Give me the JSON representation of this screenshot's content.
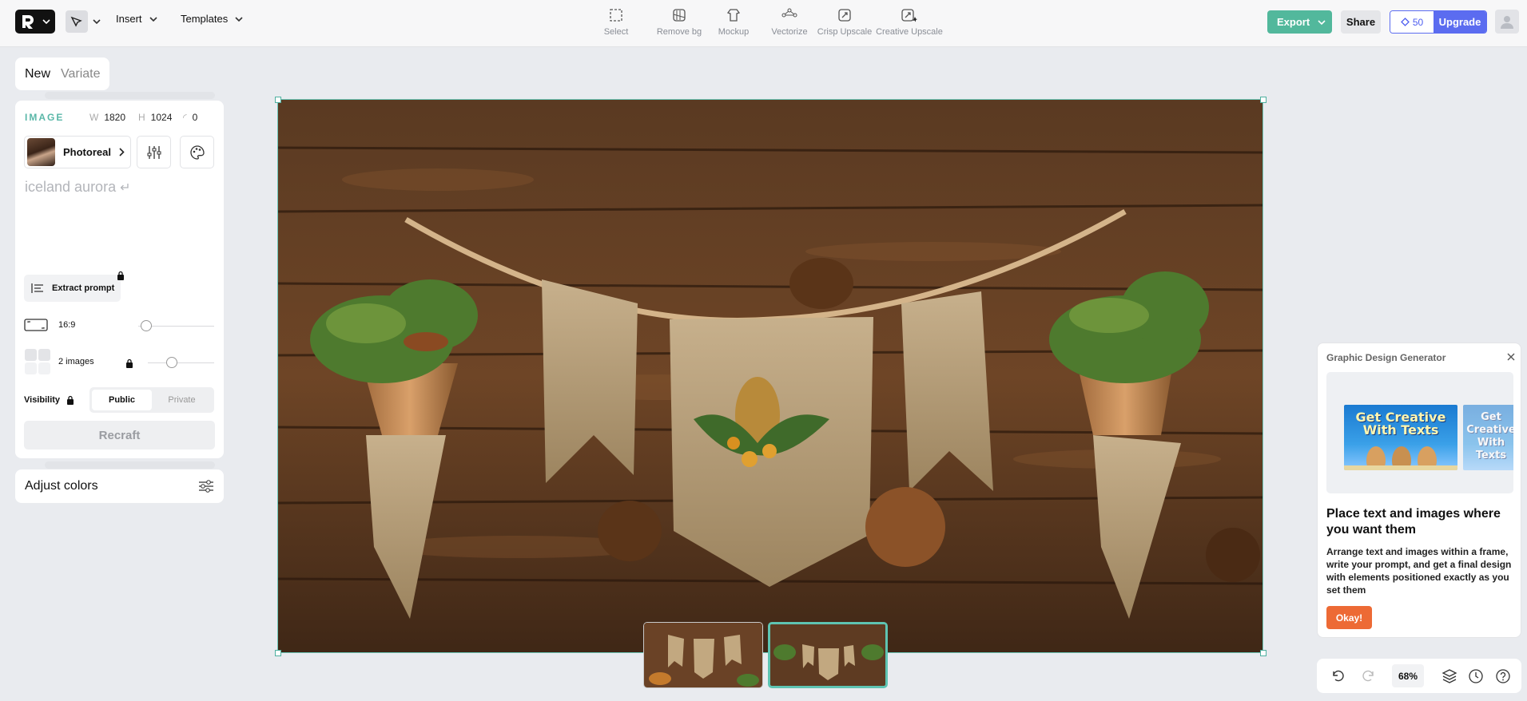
{
  "header": {
    "menus": {
      "insert": "Insert",
      "templates": "Templates"
    },
    "tools": [
      {
        "label": "Select",
        "icon": "select-icon"
      },
      {
        "label": "Remove bg",
        "icon": "remove-bg-icon"
      },
      {
        "label": "Mockup",
        "icon": "mockup-icon"
      },
      {
        "label": "Vectorize",
        "icon": "vectorize-icon"
      },
      {
        "label": "Crisp Upscale",
        "icon": "crisp-upscale-icon"
      },
      {
        "label": "Creative Upscale",
        "icon": "creative-upscale-icon"
      }
    ],
    "export_label": "Export",
    "share_label": "Share",
    "credits": "50",
    "upgrade_label": "Upgrade"
  },
  "panel": {
    "tabs": {
      "new": "New",
      "variate": "Variate"
    },
    "section_label": "IMAGE",
    "width_key": "W",
    "width": "1820",
    "height_key": "H",
    "height": "1024",
    "corner_value": "0",
    "model": "Photoreal",
    "prompt": "iceland aurora",
    "extract_label": "Extract prompt",
    "aspect_ratio": "16:9",
    "image_count": "2 images",
    "visibility_label": "Visibility",
    "visibility_options": {
      "public": "Public",
      "private": "Private"
    },
    "recraft_label": "Recraft",
    "adjust_colors": "Adjust colors"
  },
  "popover": {
    "title": "Graphic Design Generator",
    "card_text": "Get Creative With Texts",
    "heading": "Place text and images where you want them",
    "body": "Arrange text and images within a frame, write your prompt, and get a final design with elements positioned exactly as you set them",
    "ok_label": "Okay!"
  },
  "bottom": {
    "zoom": "68%"
  }
}
